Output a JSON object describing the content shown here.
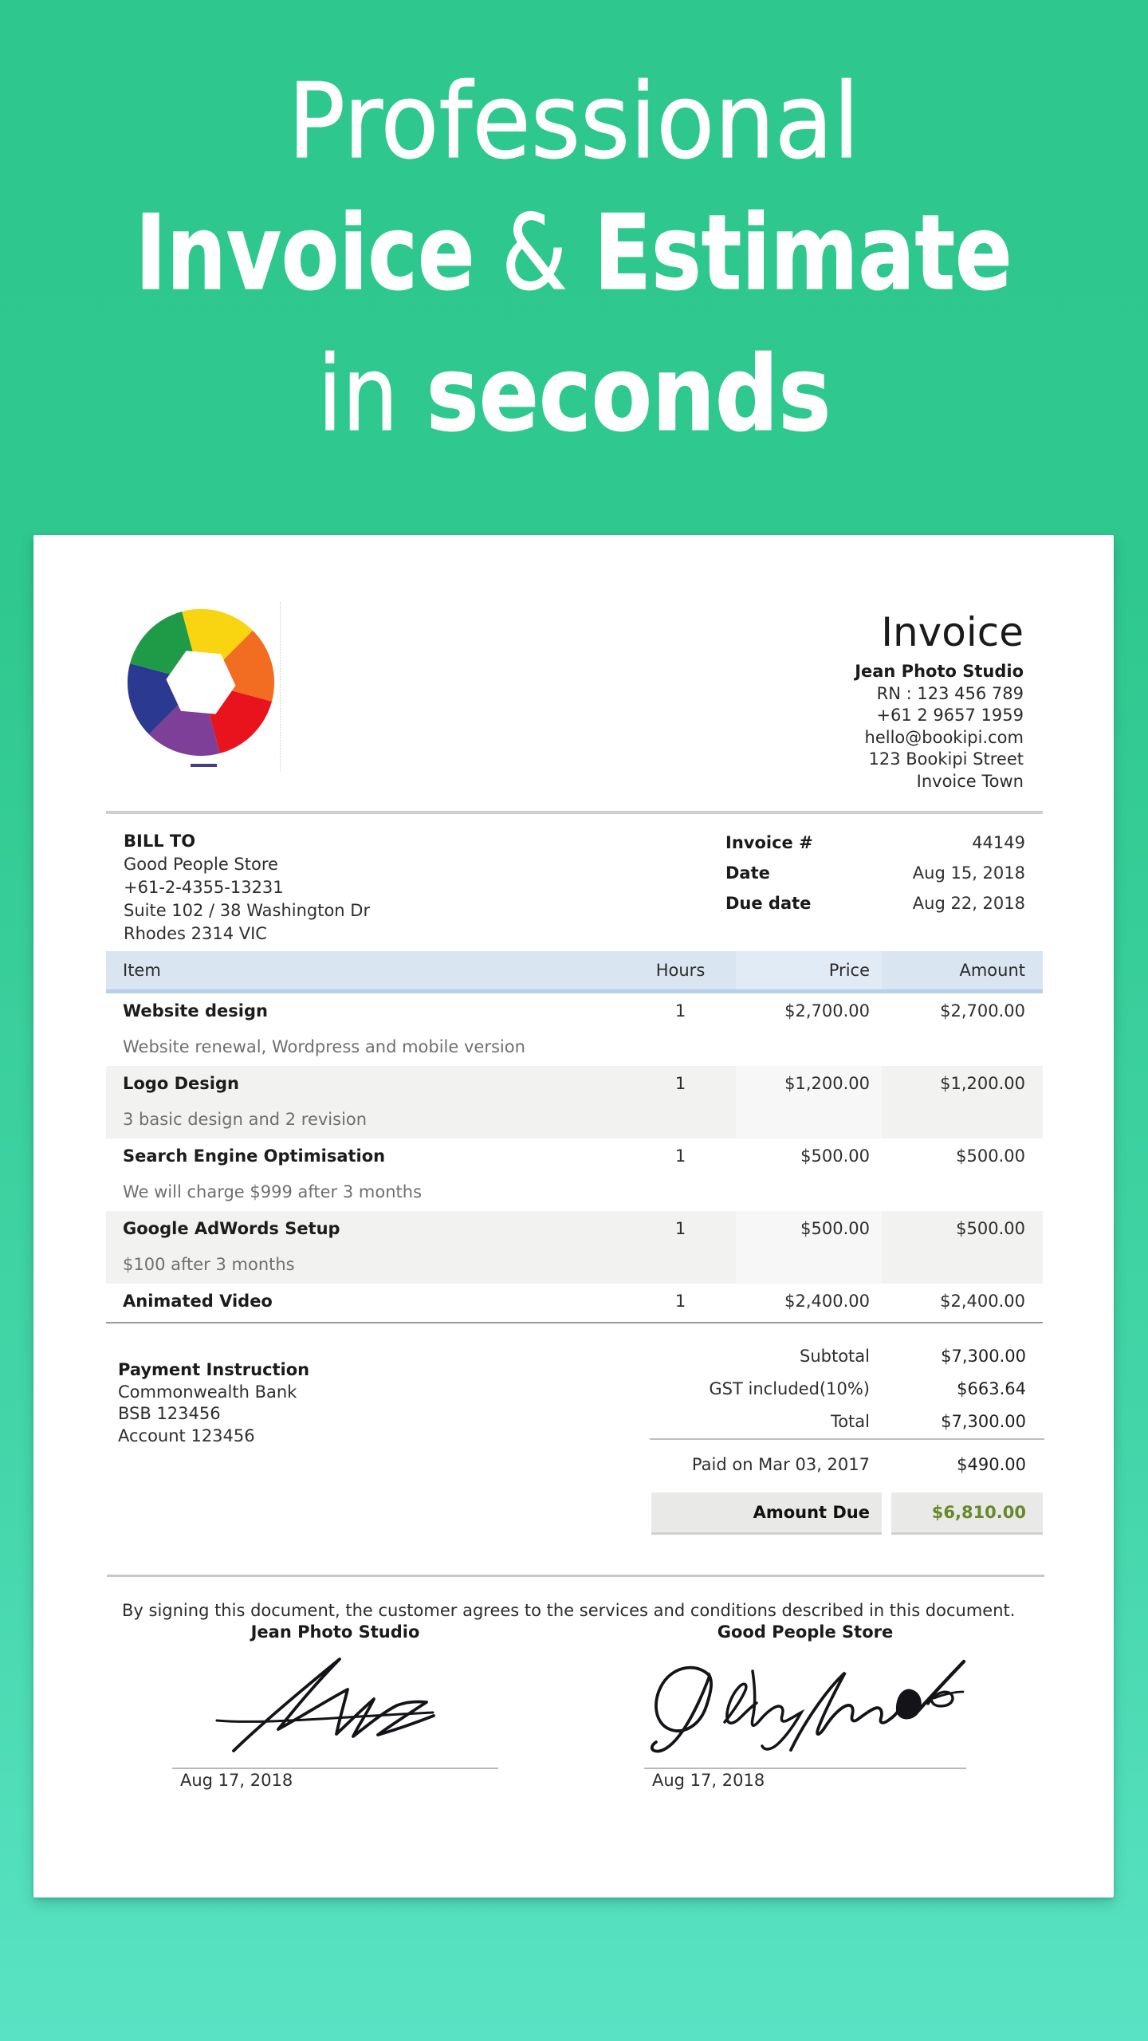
{
  "hero": {
    "line1": "Professional",
    "line2_word1": "Invoice",
    "line2_amp": "&",
    "line2_word2": "Estimate",
    "line3_word1": "in",
    "line3_word2": "seconds"
  },
  "invoice": {
    "title": "Invoice",
    "company": {
      "name": "Jean Photo Studio",
      "rn": "RN : 123 456 789",
      "phone": "+61 2 9657 1959",
      "email": "hello@bookipi.com",
      "address1": "123 Bookipi Street",
      "address2": "Invoice Town"
    },
    "bill_to": {
      "label": "BILL TO",
      "name": "Good People Store",
      "phone": "+61-2-4355-13231",
      "address1": "Suite 102 / 38 Washington Dr",
      "address2": "Rhodes 2314 VIC"
    },
    "meta": [
      {
        "label": "Invoice #",
        "value": "44149"
      },
      {
        "label": "Date",
        "value": "Aug 15, 2018"
      },
      {
        "label": "Due date",
        "value": "Aug 22, 2018"
      }
    ],
    "table": {
      "headers": [
        "Item",
        "Hours",
        "Price",
        "Amount"
      ],
      "rows": [
        {
          "name": "Website design",
          "desc": "Website renewal, Wordpress and mobile version",
          "hours": "1",
          "price": "$2,700.00",
          "amount": "$2,700.00"
        },
        {
          "name": "Logo Design",
          "desc": "3 basic design and 2 revision",
          "hours": "1",
          "price": "$1,200.00",
          "amount": "$1,200.00"
        },
        {
          "name": "Search Engine Optimisation",
          "desc": "We will charge $999 after 3 months",
          "hours": "1",
          "price": "$500.00",
          "amount": "$500.00"
        },
        {
          "name": "Google AdWords Setup",
          "desc": "$100 after 3 months",
          "hours": "1",
          "price": "$500.00",
          "amount": "$500.00"
        },
        {
          "name": "Animated Video",
          "desc": "",
          "hours": "1",
          "price": "$2,400.00",
          "amount": "$2,400.00"
        }
      ]
    },
    "payment_instruction": {
      "title": "Payment Instruction",
      "bank": "Commonwealth Bank",
      "bsb": "BSB 123456",
      "account": "Account 123456"
    },
    "totals": [
      {
        "label": "Subtotal",
        "value": "$7,300.00"
      },
      {
        "label": "GST included(10%)",
        "value": "$663.64"
      },
      {
        "label": "Total",
        "value": "$7,300.00"
      }
    ],
    "paid": {
      "label": "Paid on Mar 03, 2017",
      "value": "$490.00"
    },
    "amount_due": {
      "label": "Amount Due",
      "value": "$6,810.00"
    },
    "signing_statement": "By signing this document, the customer agrees to the services and conditions described in this document.",
    "signatures": [
      {
        "name": "Jean Photo Studio",
        "date": "Aug 17, 2018"
      },
      {
        "name": "Good People Store",
        "date": "Aug 17, 2018"
      }
    ]
  },
  "colors": {
    "background_top": "#2ec78d",
    "background_bottom": "#59e3c4",
    "heading_text": "#ffffff",
    "amount_due_value": "#66892c",
    "table_header_bg": "#d9e6f2",
    "logo_wheel": [
      "#f9d411",
      "#f26d21",
      "#e8131d",
      "#7e3f98",
      "#2b3990",
      "#1f9b48"
    ]
  }
}
